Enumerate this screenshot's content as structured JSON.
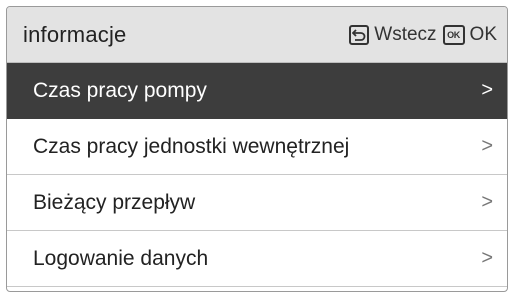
{
  "header": {
    "title": "informacje",
    "back_icon": "back-arrow-icon",
    "back_label": "Wstecz",
    "ok_key_label": "OK",
    "ok_label": "OK"
  },
  "menu": {
    "selected_index": 0,
    "items": [
      {
        "label": "Czas pracy pompy",
        "chevron": ">"
      },
      {
        "label": "Czas pracy jednostki wewnętrznej",
        "chevron": ">"
      },
      {
        "label": "Bieżący przepływ",
        "chevron": ">"
      },
      {
        "label": "Logowanie danych",
        "chevron": ">"
      }
    ]
  },
  "colors": {
    "header_bg": "#e3e3e3",
    "selected_bg": "#3d3d3d",
    "text": "#222222"
  }
}
